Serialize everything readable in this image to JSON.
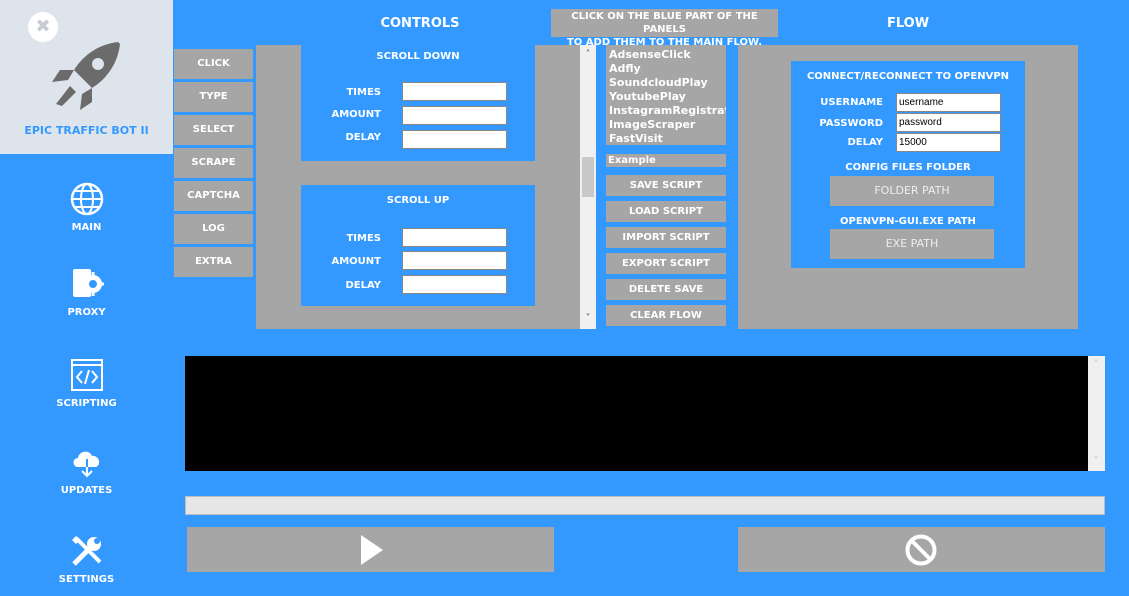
{
  "app": {
    "title": "EPIC TRAFFIC BOT II",
    "close_icon": "✖"
  },
  "sidebar": {
    "items": [
      {
        "label": "MAIN",
        "icon": "globe-icon"
      },
      {
        "label": "PROXY",
        "icon": "proxy-gear-icon"
      },
      {
        "label": "SCRIPTING",
        "icon": "code-window-icon"
      },
      {
        "label": "UPDATES",
        "icon": "cloud-download-icon"
      },
      {
        "label": "SETTINGS",
        "icon": "tools-icon"
      }
    ]
  },
  "headers": {
    "controls": "CONTROLS",
    "flow": "FLOW",
    "hint_line1": "CLICK ON THE BLUE PART OF THE PANELS",
    "hint_line2": "TO ADD THEM TO THE MAIN FLOW."
  },
  "tabs": [
    "CLICK",
    "TYPE",
    "SELECT",
    "SCRAPE",
    "CAPTCHA",
    "LOG",
    "EXTRA"
  ],
  "controls": {
    "scroll_down": {
      "title": "SCROLL DOWN",
      "times_label": "TIMES",
      "amount_label": "AMOUNT",
      "delay_label": "DELAY",
      "times_value": "",
      "amount_value": "",
      "delay_value": ""
    },
    "scroll_up": {
      "title": "SCROLL UP",
      "times_label": "TIMES",
      "amount_label": "AMOUNT",
      "delay_label": "DELAY",
      "times_value": "",
      "amount_value": "",
      "delay_value": ""
    }
  },
  "scripts": {
    "list": [
      "AdsenseClick",
      "Adfly",
      "SoundcloudPlay",
      "YoutubePlay",
      "InstagramRegistration",
      "ImageScraper",
      "FastVisit"
    ],
    "name_value": "Example",
    "buttons": [
      "SAVE SCRIPT",
      "LOAD SCRIPT",
      "IMPORT SCRIPT",
      "EXPORT SCRIPT",
      "DELETE SAVE",
      "CLEAR FLOW"
    ]
  },
  "flow": {
    "vpn": {
      "title": "CONNECT/RECONNECT TO OPENVPN",
      "username_label": "USERNAME",
      "username_value": "username",
      "password_label": "PASSWORD",
      "password_value": "password",
      "delay_label": "DELAY",
      "delay_value": "15000",
      "config_label": "CONFIG FILES FOLDER",
      "folder_button": "FOLDER PATH",
      "exe_label": "OPENVPN-GUI.EXE PATH",
      "exe_button": "EXE PATH"
    }
  },
  "colors": {
    "accent": "#3399ff",
    "panel_gray": "#a6a6a6",
    "logo_bg": "#dde4ec"
  }
}
